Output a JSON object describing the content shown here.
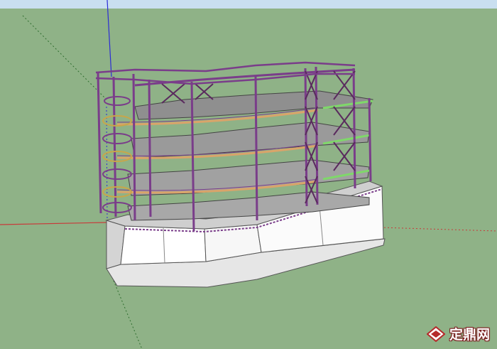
{
  "viewport": {
    "sky_color": "#c9dff0",
    "ground_color": "#8fb287"
  },
  "axes": {
    "blue_axis_color": "#2b2bd6",
    "red_axis_color": "#c83a3a",
    "green_axis_color": "#2f6e2f"
  },
  "model": {
    "structure_color": "#7a3d8a",
    "beam_color": "#d9a46a",
    "floor_color": "#9e9e9e",
    "base_color": "#f3f3f3",
    "railing_color": "#7fd86a"
  },
  "watermark": {
    "logo_icon": "zhulong-logo-icon",
    "label": "定鼎网",
    "color": "#b52a2a"
  }
}
